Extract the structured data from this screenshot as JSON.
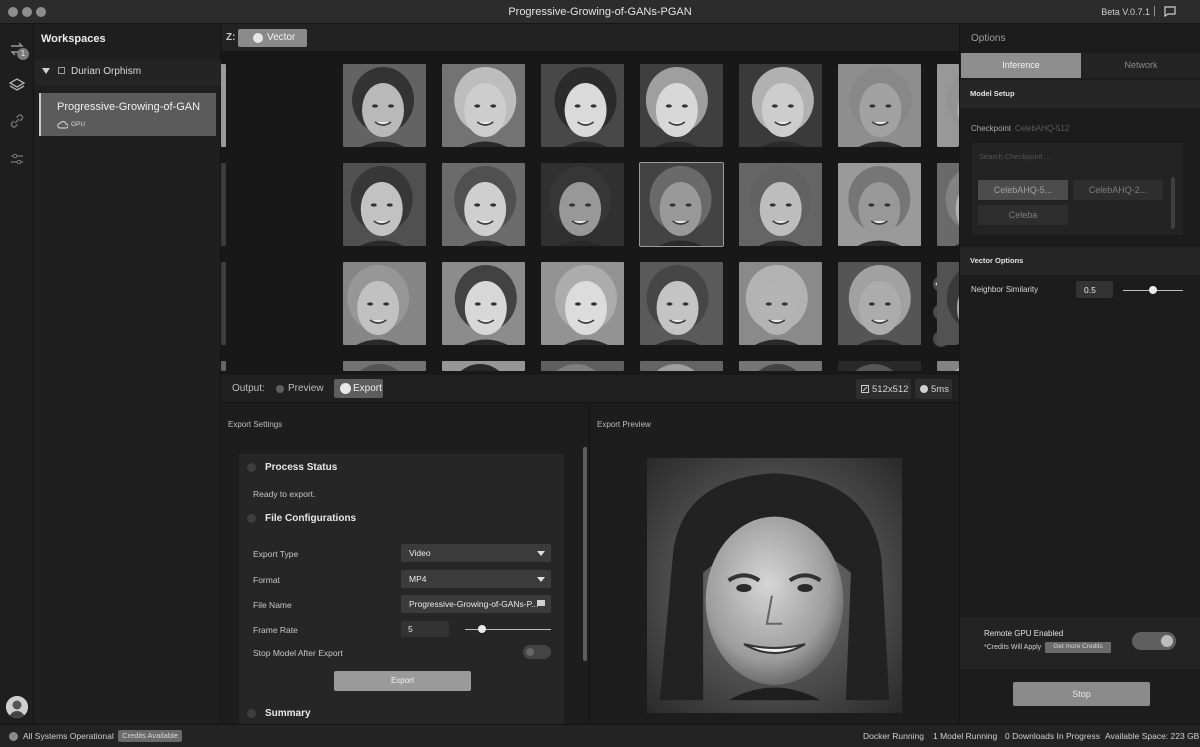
{
  "window": {
    "title": "Progressive-Growing-of-GANs-PGAN",
    "version": "Beta V.0.7.1",
    "separator": "|"
  },
  "rail": {
    "badge_count": "1"
  },
  "workspaces": {
    "title": "Workspaces",
    "group_name": "Durian Orphism",
    "item_name": "Progressive-Growing-of-GAN",
    "item_tag": "GPU"
  },
  "zbar": {
    "label": "Z:",
    "vector_label": "Vector"
  },
  "output": {
    "label": "Output:",
    "preview_label": "Preview",
    "export_label": "Export",
    "resolution": "512x512",
    "time": "5ms"
  },
  "export_settings": {
    "title": "Export Settings",
    "process_status_title": "Process Status",
    "process_status_text": "Ready to export.",
    "file_config_title": "File Configurations",
    "export_type_label": "Export Type",
    "export_type_value": "Video",
    "format_label": "Format",
    "format_value": "MP4",
    "file_name_label": "File Name",
    "file_name_value": "Progressive-Growing-of-GANs-P...",
    "frame_rate_label": "Frame Rate",
    "frame_rate_value": "5",
    "frame_rate_slider": 0.2,
    "stop_model_label": "Stop Model After Export",
    "stop_model_enabled": false,
    "export_button": "Export",
    "summary_title": "Summary"
  },
  "export_preview": {
    "title": "Export Preview"
  },
  "options": {
    "title": "Options",
    "tabs": [
      {
        "label": "Inference",
        "active": true
      },
      {
        "label": "Network",
        "active": false
      }
    ],
    "model_setup_title": "Model Setup",
    "checkpoint_label": "Checkpoint",
    "checkpoint_value": "CelebAHQ-512",
    "search_placeholder": "Search Checkpoint ...",
    "checkpoints": [
      "CelebAHQ-5...",
      "CelebAHQ-2...",
      "Celeba"
    ],
    "vector_options_title": "Vector Options",
    "neighbor_similarity_label": "Neighbor Similarity",
    "neighbor_similarity_value": "0.5",
    "remote_gpu_label": "Remote GPU Enabled",
    "credits_note": "*Credits Will Apply",
    "get_credits_label": "Get more Credits",
    "remote_gpu_enabled": true,
    "stop_button": "Stop"
  },
  "status": {
    "systems": "All Systems Operational",
    "credits": "Credits Available",
    "docker": "Docker Running",
    "models": "1 Model Running",
    "downloads": "0 Downloads In Progress",
    "space": "Available Space: 223 GB"
  },
  "colors": {
    "accent_gray": "#8a8a8a",
    "panel_dark": "#1c1c1c"
  }
}
